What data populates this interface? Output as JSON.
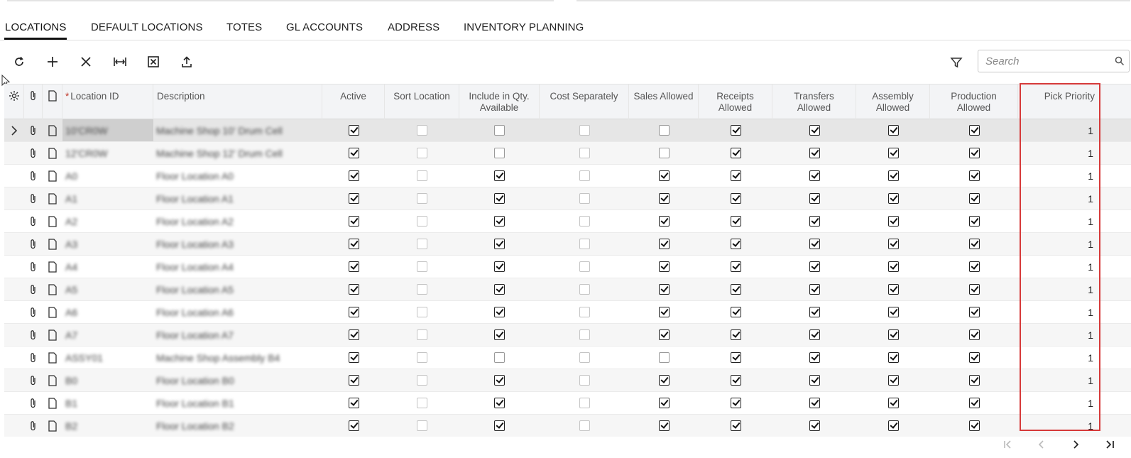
{
  "tabs": [
    "LOCATIONS",
    "DEFAULT LOCATIONS",
    "TOTES",
    "GL ACCOUNTS",
    "ADDRESS",
    "INVENTORY PLANNING"
  ],
  "active_tab": "LOCATIONS",
  "toolbar": {
    "buttons": [
      "refresh-icon",
      "add-icon",
      "delete-icon",
      "fit-columns-icon",
      "export-excel-icon",
      "upload-icon"
    ],
    "search_placeholder": "Search"
  },
  "columns": {
    "location_id": "Location ID",
    "required_mark": "*",
    "description": "Description",
    "active": "Active",
    "sort_location": "Sort Location",
    "include_in_qty": "Include in Qty. Available",
    "cost_separately": "Cost Separately",
    "sales_allowed": "Sales Allowed",
    "receipts_allowed": "Receipts Allowed",
    "transfers_allowed": "Transfers Allowed",
    "assembly_allowed": "Assembly Allowed",
    "production_allowed": "Production Allowed",
    "pick_priority": "Pick Priority"
  },
  "rows": [
    {
      "id": "10'CR0W",
      "desc": "Machine Shop 10' Drum Cell",
      "active": true,
      "sort": false,
      "incl": false,
      "cost": false,
      "sales": false,
      "rcpt": true,
      "xfer": true,
      "asm": true,
      "prod": true,
      "pick": "1"
    },
    {
      "id": "12'CR0W",
      "desc": "Machine Shop 12' Drum Cell",
      "active": true,
      "sort": false,
      "incl": false,
      "cost": false,
      "sales": false,
      "rcpt": true,
      "xfer": true,
      "asm": true,
      "prod": true,
      "pick": "1"
    },
    {
      "id": "A0",
      "desc": "Floor Location A0",
      "active": true,
      "sort": false,
      "incl": true,
      "cost": false,
      "sales": true,
      "rcpt": true,
      "xfer": true,
      "asm": true,
      "prod": true,
      "pick": "1"
    },
    {
      "id": "A1",
      "desc": "Floor Location A1",
      "active": true,
      "sort": false,
      "incl": true,
      "cost": false,
      "sales": true,
      "rcpt": true,
      "xfer": true,
      "asm": true,
      "prod": true,
      "pick": "1"
    },
    {
      "id": "A2",
      "desc": "Floor Location A2",
      "active": true,
      "sort": false,
      "incl": true,
      "cost": false,
      "sales": true,
      "rcpt": true,
      "xfer": true,
      "asm": true,
      "prod": true,
      "pick": "1"
    },
    {
      "id": "A3",
      "desc": "Floor Location A3",
      "active": true,
      "sort": false,
      "incl": true,
      "cost": false,
      "sales": true,
      "rcpt": true,
      "xfer": true,
      "asm": true,
      "prod": true,
      "pick": "1"
    },
    {
      "id": "A4",
      "desc": "Floor Location A4",
      "active": true,
      "sort": false,
      "incl": true,
      "cost": false,
      "sales": true,
      "rcpt": true,
      "xfer": true,
      "asm": true,
      "prod": true,
      "pick": "1"
    },
    {
      "id": "A5",
      "desc": "Floor Location A5",
      "active": true,
      "sort": false,
      "incl": true,
      "cost": false,
      "sales": true,
      "rcpt": true,
      "xfer": true,
      "asm": true,
      "prod": true,
      "pick": "1"
    },
    {
      "id": "A6",
      "desc": "Floor Location A6",
      "active": true,
      "sort": false,
      "incl": true,
      "cost": false,
      "sales": true,
      "rcpt": true,
      "xfer": true,
      "asm": true,
      "prod": true,
      "pick": "1"
    },
    {
      "id": "A7",
      "desc": "Floor Location A7",
      "active": true,
      "sort": false,
      "incl": true,
      "cost": false,
      "sales": true,
      "rcpt": true,
      "xfer": true,
      "asm": true,
      "prod": true,
      "pick": "1"
    },
    {
      "id": "ASSY01",
      "desc": "Machine Shop Assembly B4",
      "active": true,
      "sort": false,
      "incl": false,
      "cost": false,
      "sales": false,
      "rcpt": true,
      "xfer": true,
      "asm": true,
      "prod": true,
      "pick": "1"
    },
    {
      "id": "B0",
      "desc": "Floor Location B0",
      "active": true,
      "sort": false,
      "incl": true,
      "cost": false,
      "sales": true,
      "rcpt": true,
      "xfer": true,
      "asm": true,
      "prod": true,
      "pick": "1"
    },
    {
      "id": "B1",
      "desc": "Floor Location B1",
      "active": true,
      "sort": false,
      "incl": true,
      "cost": false,
      "sales": true,
      "rcpt": true,
      "xfer": true,
      "asm": true,
      "prod": true,
      "pick": "1"
    },
    {
      "id": "B2",
      "desc": "Floor Location B2",
      "active": true,
      "sort": false,
      "incl": true,
      "cost": false,
      "sales": true,
      "rcpt": true,
      "xfer": true,
      "asm": true,
      "prod": true,
      "pick": "1"
    }
  ],
  "pager": [
    "first-page-icon",
    "prev-page-icon",
    "next-page-icon",
    "last-page-icon"
  ]
}
